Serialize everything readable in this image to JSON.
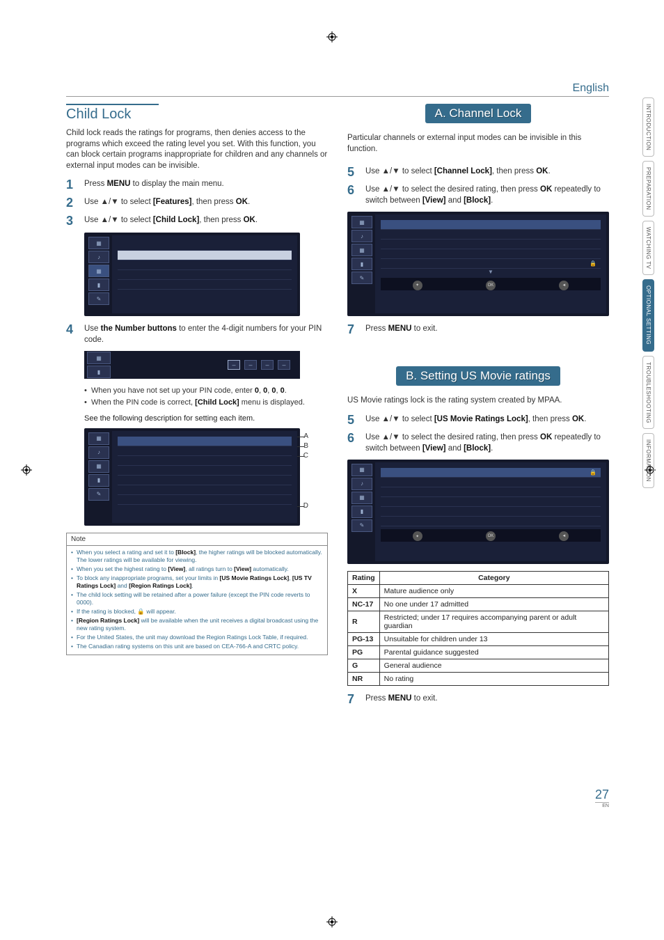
{
  "language": "English",
  "page_number": "27",
  "page_suffix": "EN",
  "side_tabs": [
    "INTRODUCTION",
    "PREPARATION",
    "WATCHING TV",
    "OPTIONAL SETTING",
    "TROUBLESHOOTING",
    "INFORMATION"
  ],
  "side_active_index": 3,
  "left": {
    "title": "Child Lock",
    "intro": "Child lock reads the ratings for programs, then denies access to the programs which exceed the rating level you set. With this function, you can block certain programs inappropriate for children and any channels or external input modes can be invisible.",
    "steps": {
      "s1": "Press <b>MENU</b> to display the main menu.",
      "s2": "Use <span class='arrow'>▲/▼</span> to select <b>[Features]</b>, then press <b>OK</b>.",
      "s3": "Use <span class='arrow'>▲/▼</span> to select <b>[Child Lock]</b>, then press <b>OK</b>.",
      "s4": "Use <b>the Number buttons</b> to enter the 4-digit numbers for your PIN code."
    },
    "bullets": [
      "When you have not set up your PIN code, enter <b>0</b>, <b>0</b>, <b>0</b>, <b>0</b>.",
      "When the PIN code is correct, <b>[Child Lock]</b> menu is displayed."
    ],
    "see_following": "See the following description for setting each item.",
    "callout_labels": [
      "A",
      "B",
      "C",
      "D"
    ],
    "note_title": "Note",
    "note_items": [
      "When you select a rating and set it to <b>[Block]</b>, the higher ratings will be blocked automatically. The lower ratings will be available for viewing.",
      "When you set the highest rating to <b>[View]</b>, all ratings turn to <b>[View]</b> automatically.",
      "To block any inappropriate programs, set your limits in <b>[US Movie Ratings Lock]</b>, <b>[US TV Ratings Lock]</b> and <b>[Region Ratings Lock]</b>.",
      "The child lock setting will be retained after a power failure (except the PIN code reverts to 0000).",
      "If the rating is blocked, 🔒 will appear.",
      "<b>[Region Ratings Lock]</b> will be available when the unit receives a digital broadcast using the new rating system.",
      "For the United States, the unit may download the Region Ratings Lock Table, if required.",
      "The Canadian rating systems on this unit are based on CEA-766-A and CRTC policy."
    ]
  },
  "rightA": {
    "heading": "A. Channel Lock",
    "intro": "Particular channels or external input modes can be invisible in this function.",
    "s5": "Use <span class='arrow'>▲/▼</span> to select <b>[Channel Lock]</b>, then press <b>OK</b>.",
    "s6": "Use <span class='arrow'>▲/▼</span> to select the desired rating, then press <b>OK</b> repeatedly to switch between <b>[View]</b> and <b>[Block]</b>.",
    "s7": "Press <b>MENU</b> to exit."
  },
  "rightB": {
    "heading": "B. Setting US Movie ratings",
    "intro": "US Movie ratings lock is the rating system created by MPAA.",
    "s5": "Use <span class='arrow'>▲/▼</span> to select <b>[US Movie Ratings Lock]</b>, then press <b>OK</b>.",
    "s6": "Use <span class='arrow'>▲/▼</span> to select the desired rating, then press <b>OK</b> repeatedly to switch between <b>[View]</b> and <b>[Block]</b>.",
    "s7": "Press <b>MENU</b> to exit.",
    "table_head": {
      "rating": "Rating",
      "category": "Category"
    },
    "table": [
      {
        "r": "X",
        "c": "Mature audience only"
      },
      {
        "r": "NC-17",
        "c": "No one under 17 admitted"
      },
      {
        "r": "R",
        "c": "Restricted; under 17 requires accompanying parent or adult guardian"
      },
      {
        "r": "PG-13",
        "c": "Unsuitable for children under 13"
      },
      {
        "r": "PG",
        "c": "Parental guidance suggested"
      },
      {
        "r": "G",
        "c": "General audience"
      },
      {
        "r": "NR",
        "c": "No rating"
      }
    ]
  }
}
